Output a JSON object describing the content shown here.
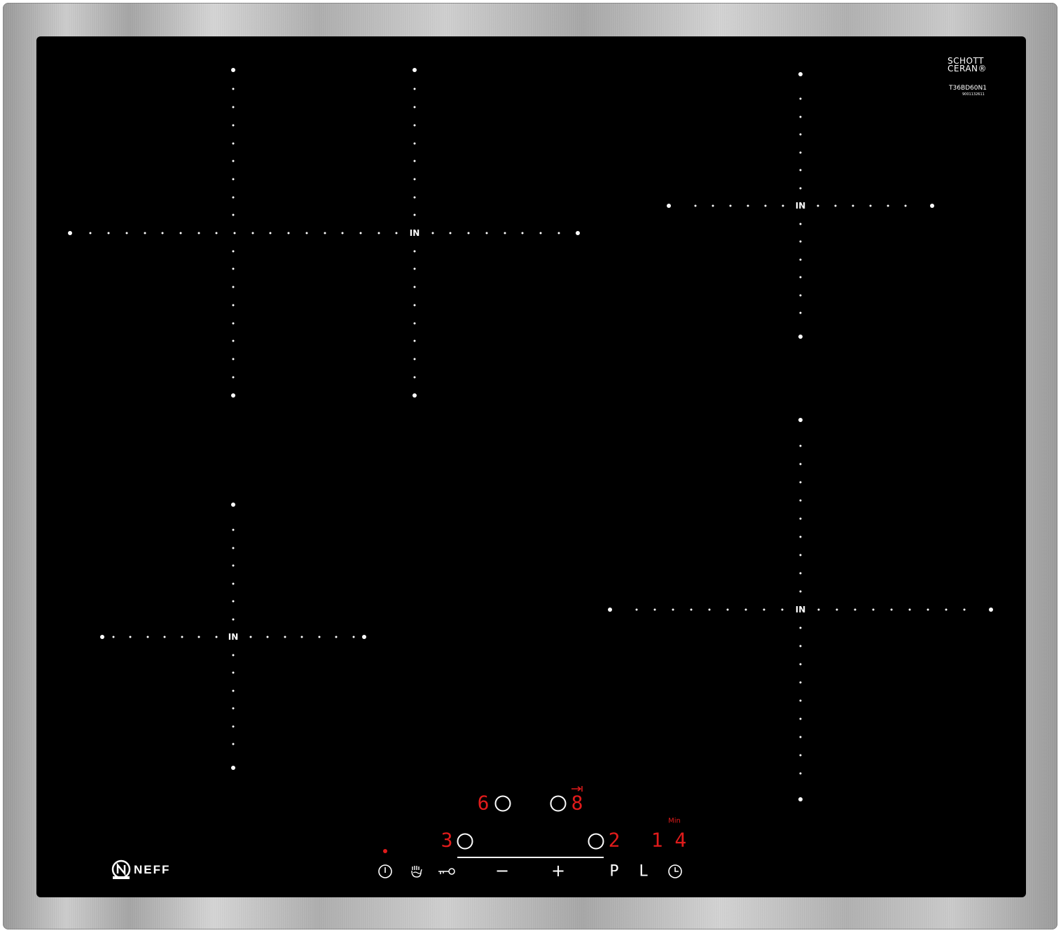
{
  "brand": {
    "logo_text": "NEFF",
    "glass_brand_line1": "SCHOTT",
    "glass_brand_line2": "CERAN®",
    "model": "T36BD60N1",
    "serial": "9001132611"
  },
  "cooking_zone_label": "IN",
  "zone_indicators": {
    "front_left_level": "3",
    "rear_left_level": "6",
    "rear_right_level": "8",
    "front_right_level": "2"
  },
  "timer": {
    "unit": "Min",
    "value": "1 4"
  },
  "controls": {
    "minus": "−",
    "plus": "+",
    "power_boost": "P",
    "lock_label": "L"
  },
  "colors": {
    "glass": "#000000",
    "display_red": "#e01b1b",
    "frame_steel": "#b8b8b8"
  }
}
